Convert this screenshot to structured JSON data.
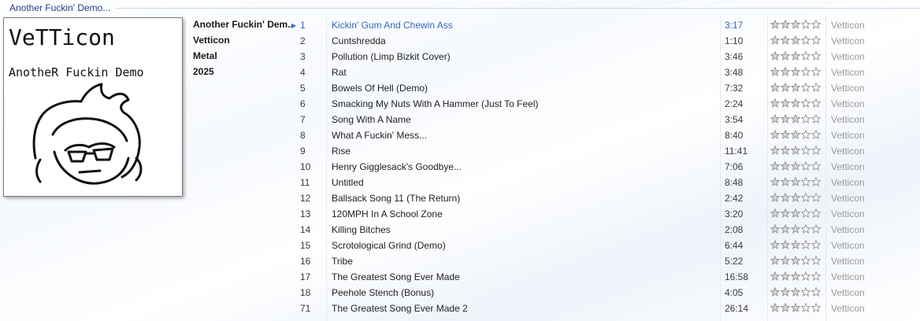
{
  "group": {
    "title": "Another Fuckin' Demo..."
  },
  "album": {
    "title": "Another Fuckin' Dem...",
    "artist": "Vetticon",
    "genre": "Metal",
    "year": "2025",
    "cover": {
      "line1": "VeTTicon",
      "line2": "AnotheR Fuckin Demo"
    }
  },
  "now_playing_index": 0,
  "tracks": [
    {
      "num": "1",
      "title": "Kickin' Gum And Chewin Ass",
      "length": "3:17",
      "rating": 3,
      "artist": "Vetticon"
    },
    {
      "num": "2",
      "title": "Cuntshredda",
      "length": "1:10",
      "rating": 3,
      "artist": "Vetticon"
    },
    {
      "num": "3",
      "title": "Pollution (Limp Bizkit Cover)",
      "length": "3:46",
      "rating": 3,
      "artist": "Vetticon"
    },
    {
      "num": "4",
      "title": "Rat",
      "length": "3:48",
      "rating": 3,
      "artist": "Vetticon"
    },
    {
      "num": "5",
      "title": "Bowels Of Hell (Demo)",
      "length": "7:32",
      "rating": 3,
      "artist": "Vetticon"
    },
    {
      "num": "6",
      "title": "Smacking My Nuts With A Hammer (Just To Feel)",
      "length": "2:24",
      "rating": 3,
      "artist": "Vetticon"
    },
    {
      "num": "7",
      "title": "Song With A Name",
      "length": "3:54",
      "rating": 3,
      "artist": "Vetticon"
    },
    {
      "num": "8",
      "title": "What A Fuckin' Mess...",
      "length": "8:40",
      "rating": 3,
      "artist": "Vetticon"
    },
    {
      "num": "9",
      "title": "Rise",
      "length": "11:41",
      "rating": 3,
      "artist": "Vetticon"
    },
    {
      "num": "10",
      "title": "Henry Gigglesack's Goodbye...",
      "length": "7:06",
      "rating": 3,
      "artist": "Vetticon"
    },
    {
      "num": "11",
      "title": "Untitled",
      "length": "8:48",
      "rating": 3,
      "artist": "Vetticon"
    },
    {
      "num": "12",
      "title": "Ballsack Song 11 (The Return)",
      "length": "2:42",
      "rating": 3,
      "artist": "Vetticon"
    },
    {
      "num": "13",
      "title": "120MPH In A School Zone",
      "length": "3:20",
      "rating": 3,
      "artist": "Vetticon"
    },
    {
      "num": "14",
      "title": "Killing Bitches",
      "length": "2:08",
      "rating": 3,
      "artist": "Vetticon"
    },
    {
      "num": "15",
      "title": "Scrotological Grind (Demo)",
      "length": "6:44",
      "rating": 3,
      "artist": "Vetticon"
    },
    {
      "num": "16",
      "title": "Tribe",
      "length": "5:22",
      "rating": 3,
      "artist": "Vetticon"
    },
    {
      "num": "17",
      "title": "The Greatest Song Ever Made",
      "length": "16:58",
      "rating": 3,
      "artist": "Vetticon"
    },
    {
      "num": "18",
      "title": "Peehole Stench (Bonus)",
      "length": "4:05",
      "rating": 3,
      "artist": "Vetticon"
    },
    {
      "num": "71",
      "title": "The Greatest Song Ever Made 2",
      "length": "26:14",
      "rating": 3,
      "artist": "Vetticon"
    }
  ],
  "colors": {
    "accent": "#2f6ab7",
    "header_text": "#1e3d8a",
    "muted": "#9a9a9a"
  },
  "icons": {
    "now_playing": "play-arrow-icon",
    "rating": "star-icon"
  }
}
